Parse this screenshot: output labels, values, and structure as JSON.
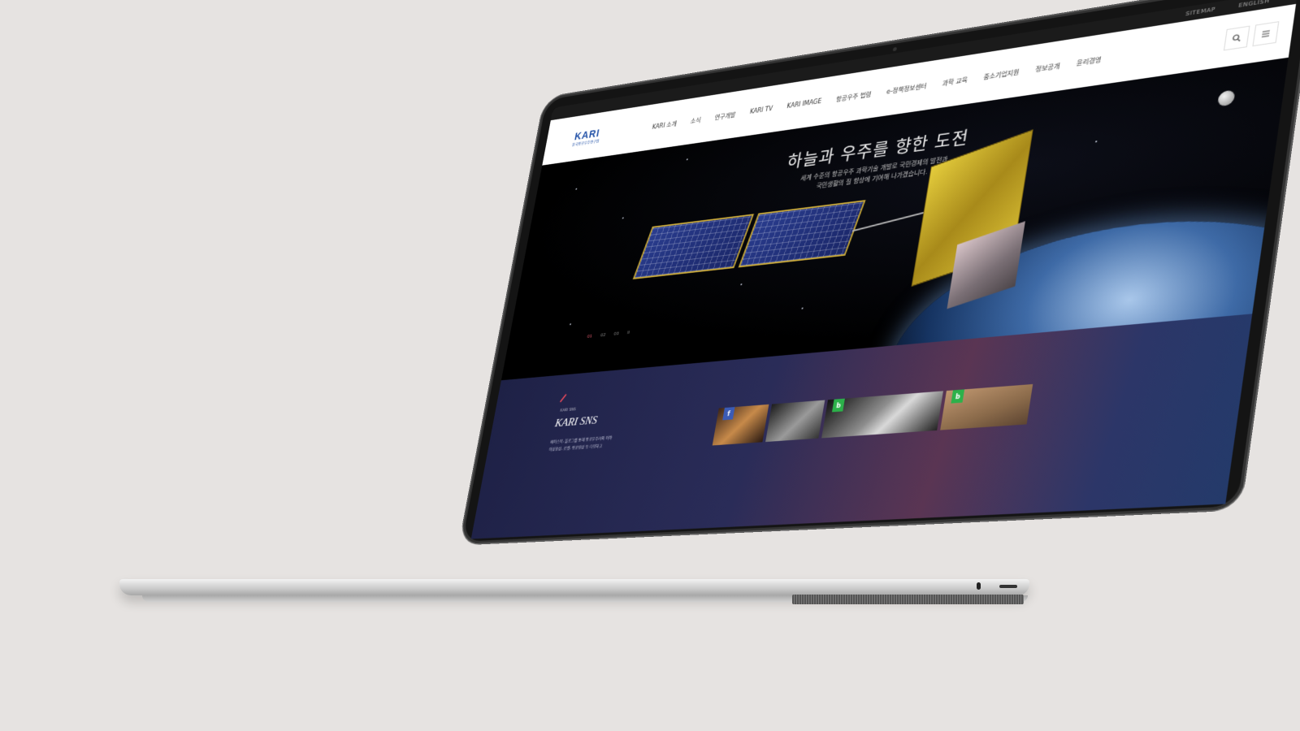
{
  "util_links": [
    "SITEMAP",
    "ENGLISH"
  ],
  "logo": {
    "mark": "KARI",
    "sub": "한국항공우주연구원"
  },
  "menu": [
    "KARI 소개",
    "소식",
    "연구개발",
    "KARI TV",
    "KARI IMAGE",
    "항공우주 법령",
    "e-정책정보센터",
    "과학 교육",
    "중소기업지원",
    "정보공개",
    "윤리경영"
  ],
  "icons": {
    "search": "search-icon",
    "menu": "hamburger-icon"
  },
  "hero": {
    "title": "하늘과 우주를 향한 도전",
    "subtitle_line1": "세계 수준의 항공우주 과학기술 개발로 국민경제의 발전과",
    "subtitle_line2": "국민생활의 질 향상에 기여해 나가겠습니다.",
    "pager": [
      "01",
      "02",
      "03",
      "II"
    ]
  },
  "sns": {
    "kicker": "KARI SNS",
    "title": "KARI SNS",
    "desc_line1": "페이스북, 블로그를 통해 항공우주러의 이야",
    "desc_line2": "이상한상, 로켓, 항공영상 등 다양하고",
    "badges": [
      "f",
      "b",
      "b"
    ]
  },
  "colors": {
    "accent": "#e2485b",
    "brand": "#1f4fa6",
    "facebook": "#3b5bb5",
    "blog": "#2cb14a"
  }
}
